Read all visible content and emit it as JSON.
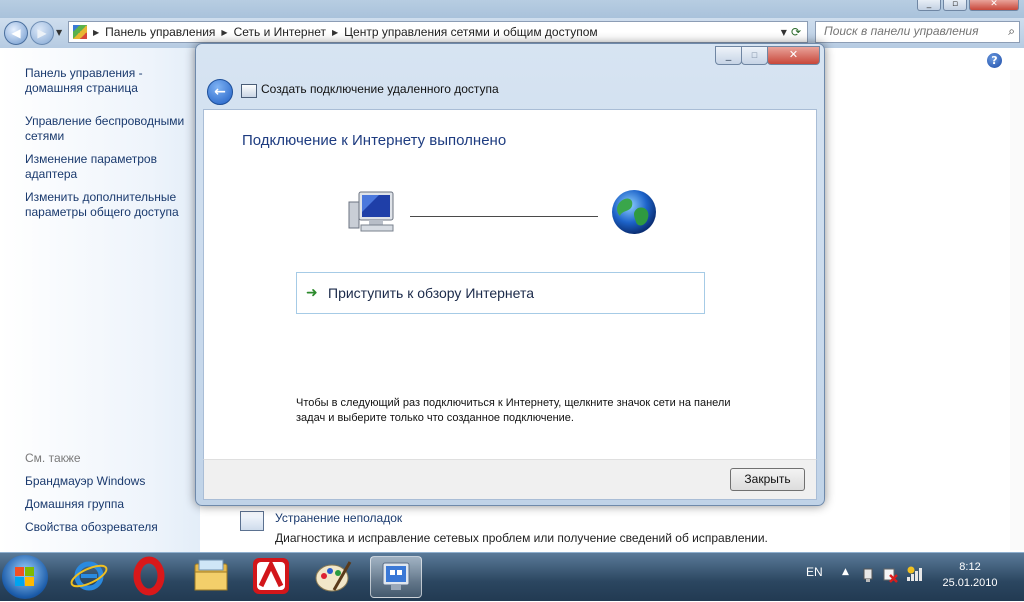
{
  "address": {
    "crumbs": [
      "Панель управления",
      "Сеть и Интернет",
      "Центр управления сетями и общим доступом"
    ]
  },
  "search": {
    "placeholder": "Поиск в панели управления"
  },
  "sidebar": {
    "items": [
      {
        "label": "Панель управления - домашняя страница"
      },
      {
        "label": "Управление беспроводными сетями"
      },
      {
        "label": "Изменение параметров адаптера"
      },
      {
        "label": "Изменить дополнительные параметры общего доступа"
      }
    ],
    "see_also_heading": "См. также",
    "see_also": [
      {
        "label": "Брандмауэр Windows"
      },
      {
        "label": "Домашняя группа"
      },
      {
        "label": "Свойства обозревателя"
      }
    ]
  },
  "content": {
    "troubleshoot_link": "Устранение неполадок",
    "troubleshoot_desc": "Диагностика и исправление сетевых проблем или получение сведений об исправлении."
  },
  "dialog": {
    "title": "Создать подключение удаленного доступа",
    "heading": "Подключение к Интернету выполнено",
    "browse_label": "Приступить к обзору Интернета",
    "info_text": "Чтобы в следующий раз подключиться к Интернету, щелкните значок сети на панели задач и выберите только что созданное подключение.",
    "close_label": "Закрыть"
  },
  "taskbar": {
    "apps": [
      "internet-explorer-icon",
      "opera-icon",
      "explorer-folder-icon",
      "avira-icon",
      "paint-icon",
      "network-center-icon"
    ],
    "active_app": "network-center-icon"
  },
  "tray": {
    "lang": "EN",
    "time": "8:12",
    "date": "25.01.2010"
  },
  "colors": {
    "link": "#1a3a6e",
    "heading": "#1e3c80",
    "taskbar": "#2b4660"
  }
}
